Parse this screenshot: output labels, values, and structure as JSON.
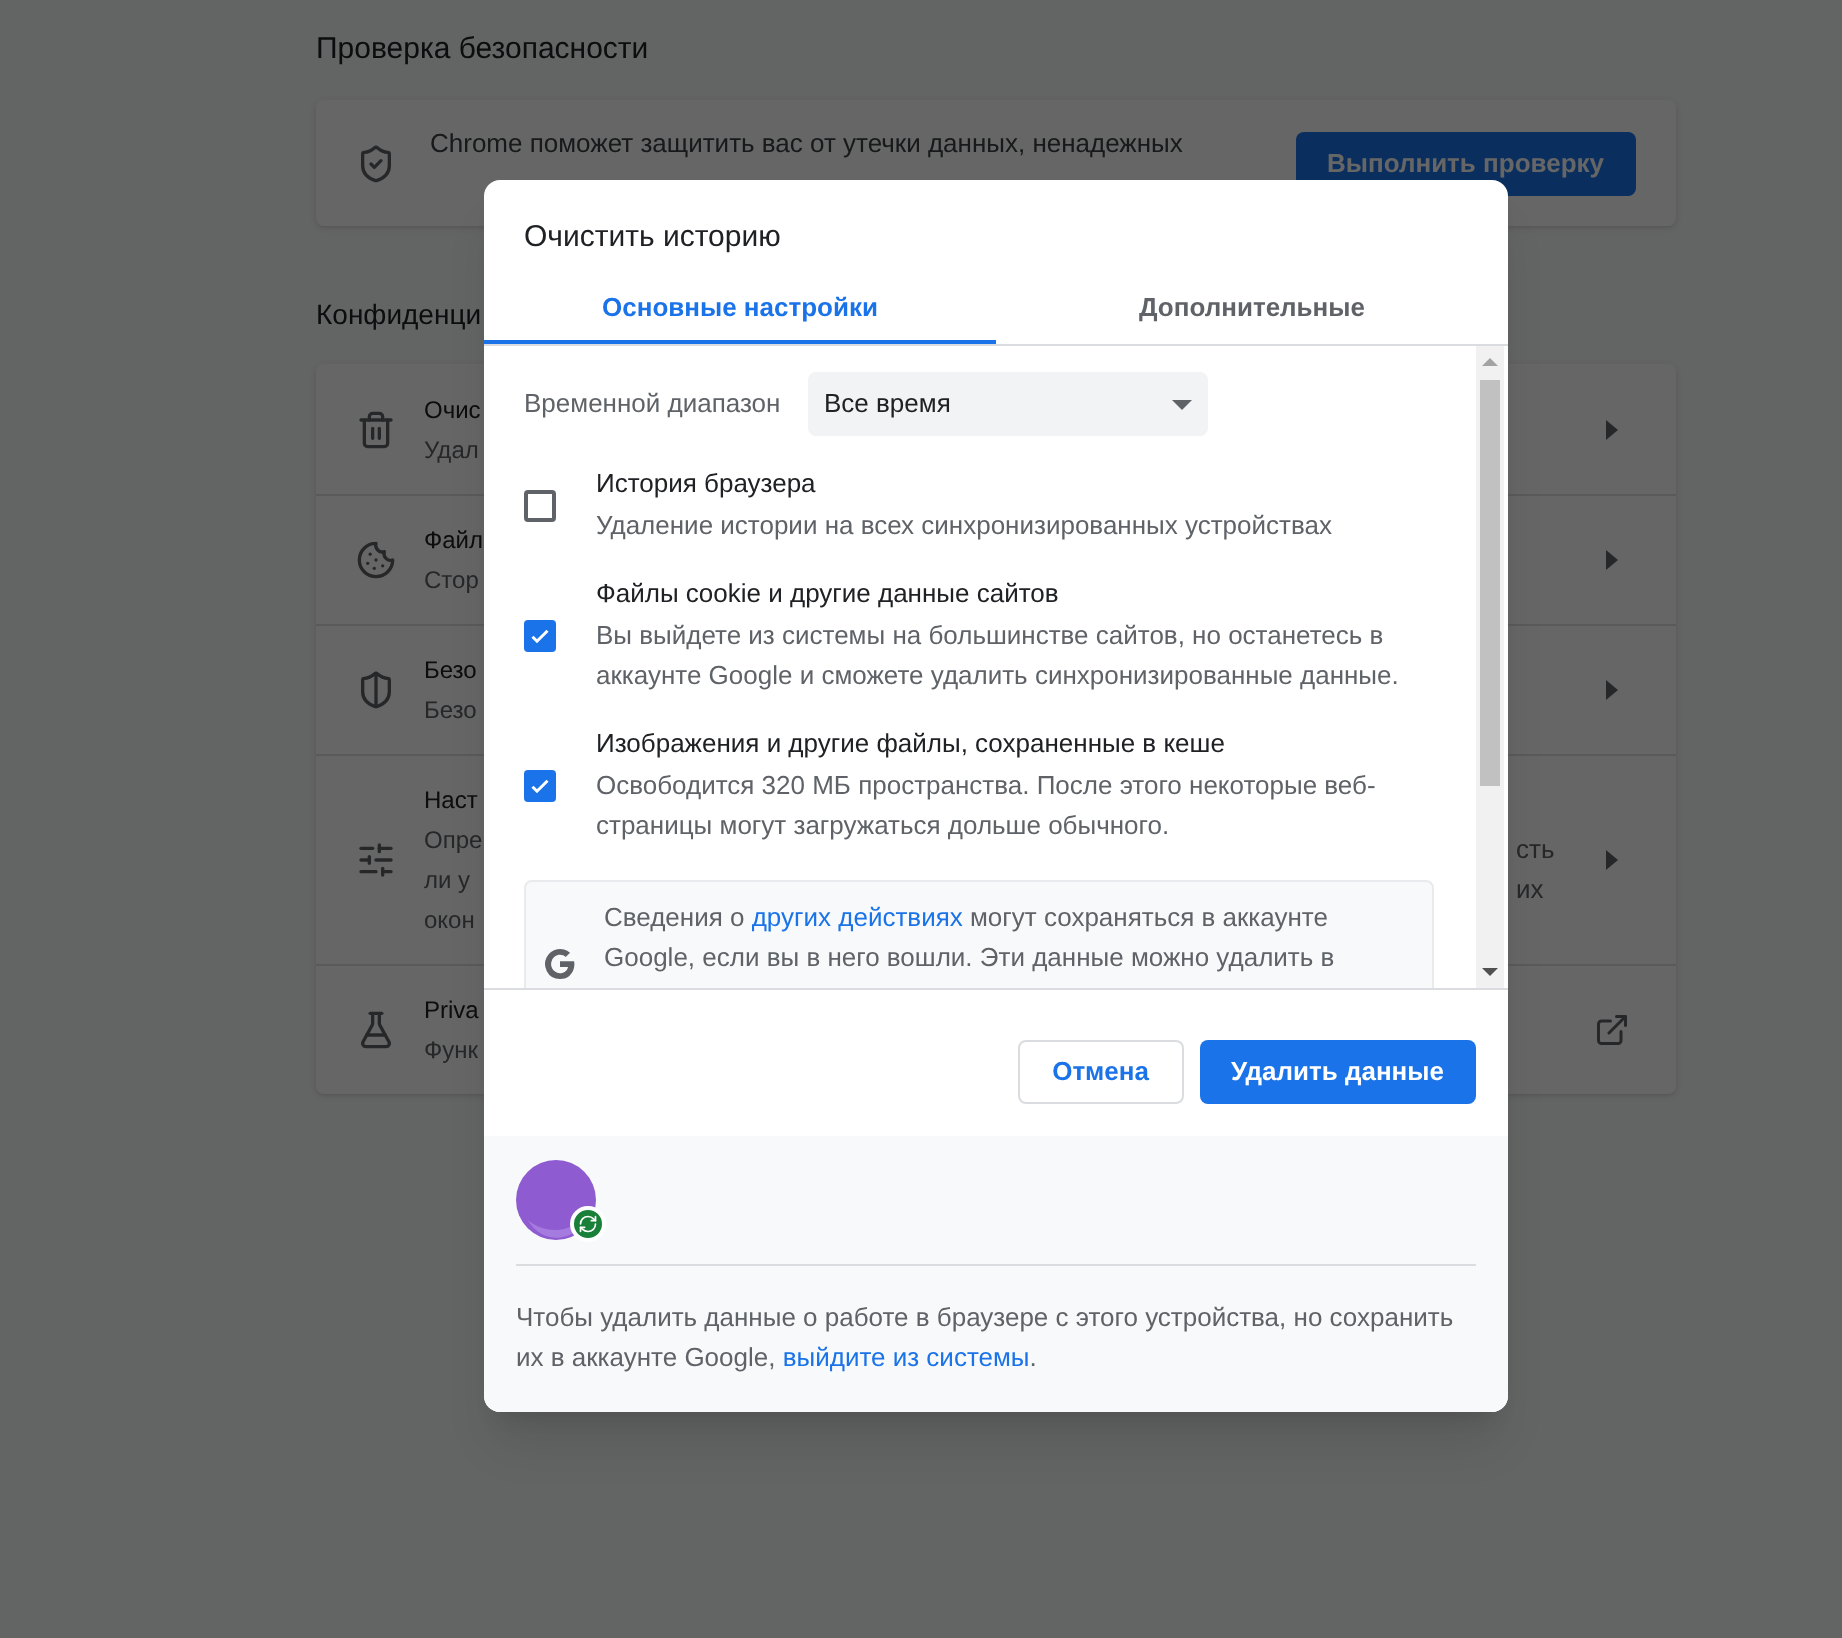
{
  "page": {
    "safety": {
      "heading": "Проверка безопасности",
      "text": "Chrome поможет защитить вас от утечки данных, ненадежных",
      "button": "Выполнить проверку"
    },
    "privacy": {
      "heading": "Конфиденци",
      "rows": [
        {
          "kind": "trash",
          "lines": [
            "Очис",
            "Удал"
          ],
          "right_lines": [],
          "external": false
        },
        {
          "kind": "cookie",
          "lines": [
            "Файл",
            "Стор"
          ],
          "right_lines": [],
          "external": false
        },
        {
          "kind": "shield",
          "lines": [
            "Безо",
            "Безо"
          ],
          "right_lines": [],
          "external": false
        },
        {
          "kind": "sliders",
          "lines": [
            "Наст",
            "Опре",
            "ли у",
            "окон"
          ],
          "right_lines": [
            "сть",
            "их"
          ],
          "external": false
        },
        {
          "kind": "flask",
          "lines": [
            "Priva",
            "Функ"
          ],
          "right_lines": [],
          "external": true
        }
      ]
    }
  },
  "dialog": {
    "title": "Очистить историю",
    "tabs": [
      {
        "label": "Основные настройки",
        "selected": true
      },
      {
        "label": "Дополнительные",
        "selected": false
      }
    ],
    "time_range": {
      "label": "Временной диапазон",
      "value": "Все время"
    },
    "items": [
      {
        "title": "История браузера",
        "description": "Удаление истории на всех синхронизированных устройствах",
        "checked": false
      },
      {
        "title": "Файлы cookie и другие данные сайтов",
        "description": "Вы выйдете из системы на большинстве сайтов, но останетесь в аккаунте Google и сможете удалить синхронизированные данные.",
        "checked": true
      },
      {
        "title": "Изображения и другие файлы, сохраненные в кеше",
        "description": "Освободится 320 МБ пространства. После этого некоторые веб-страницы могут загружаться дольше обычного.",
        "checked": true
      }
    ],
    "info": {
      "before": "Сведения о ",
      "link": "других действиях",
      "after": " могут сохраняться в аккаунте Google, если вы в него вошли. Эти данные можно удалить в"
    },
    "buttons": {
      "cancel": "Отмена",
      "confirm": "Удалить данные"
    },
    "footer": {
      "before": "Чтобы удалить данные о работе в браузере с этого устройства, но сохранить их в аккаунте Google, ",
      "link": "выйдите из системы",
      "after": "."
    }
  }
}
